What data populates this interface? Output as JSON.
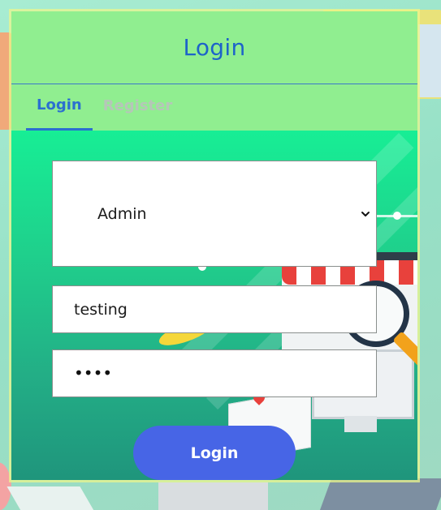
{
  "header": {
    "title": "Login"
  },
  "tabs": [
    {
      "label": "Login",
      "active": true
    },
    {
      "label": "Register",
      "active": false
    }
  ],
  "form": {
    "role_select": {
      "selected": "Admin"
    },
    "username": {
      "value": "testing"
    },
    "password": {
      "masked_value": "••••"
    },
    "submit_label": "Login"
  },
  "colors": {
    "header_bg": "#90ee90",
    "title_text": "#1d63c9",
    "active_tab": "#2b6fd0",
    "inactive_tab": "#b6c6b9",
    "body_gradient_top": "#17ee95",
    "body_gradient_bottom": "#1f957c",
    "submit_button": "#4765e6"
  },
  "icons": {
    "select_arrow": "chevron-down-icon"
  }
}
